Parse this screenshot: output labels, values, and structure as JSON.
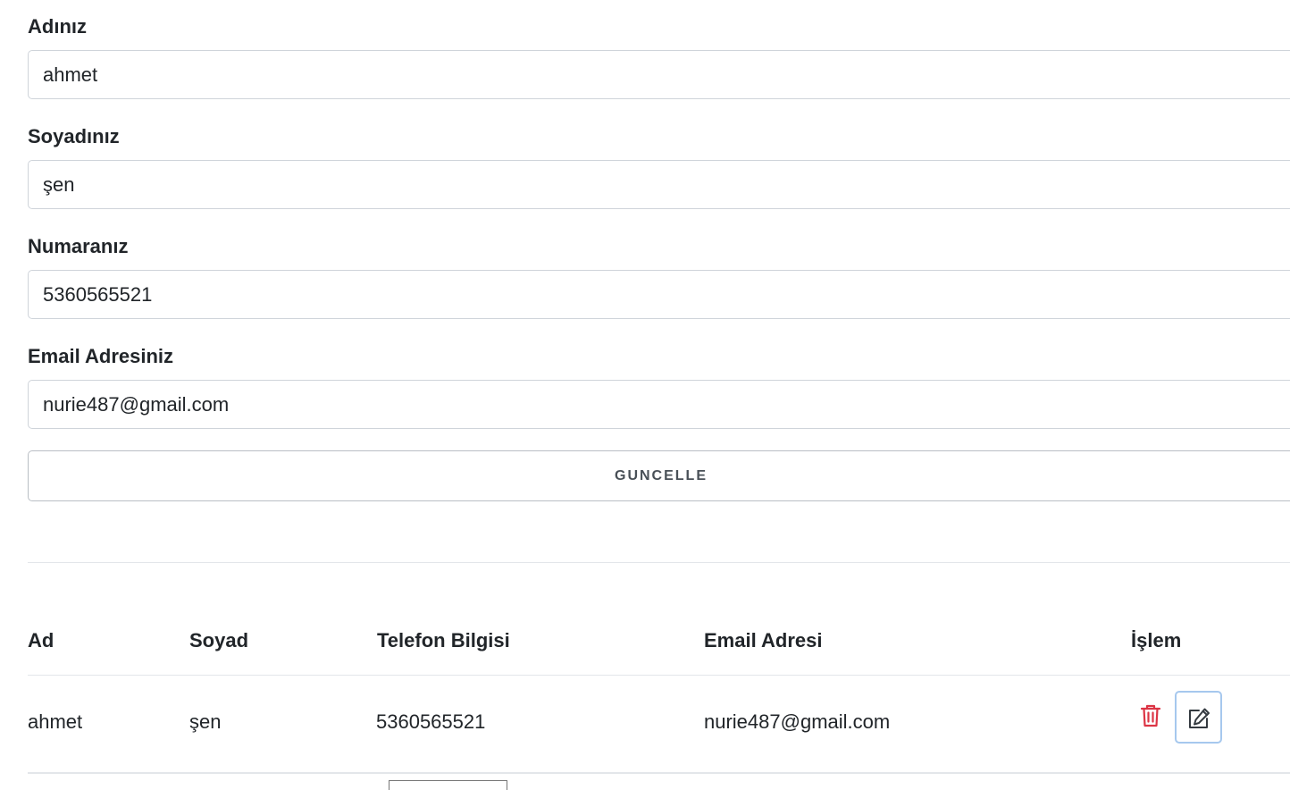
{
  "form": {
    "first_name": {
      "label": "Adınız",
      "value": "ahmet"
    },
    "last_name": {
      "label": "Soyadınız",
      "value": "şen"
    },
    "phone": {
      "label": "Numaranız",
      "value": "5360565521"
    },
    "email": {
      "label": "Email Adresiniz",
      "value": "nurie487@gmail.com"
    },
    "submit_label": "GUNCELLE"
  },
  "table": {
    "headers": [
      "Ad",
      "Soyad",
      "Telefon Bilgisi",
      "Email Adresi",
      "İşlem"
    ],
    "rows": [
      [
        "ahmet",
        "şen",
        "5360565521",
        "nurie487@gmail.com"
      ]
    ],
    "actions": {
      "delete_icon": "trash-icon",
      "edit_icon": "pencil-square-icon",
      "delete_color": "#dc3545",
      "edit_border_color": "#a6c8ee"
    }
  }
}
